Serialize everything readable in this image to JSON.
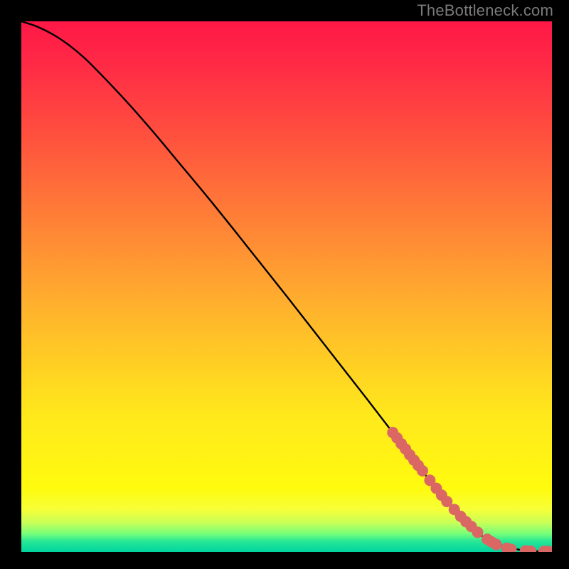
{
  "watermark": "TheBottleneck.com",
  "chart_data": {
    "type": "line",
    "title": "",
    "xlabel": "",
    "ylabel": "",
    "xlim": [
      0,
      100
    ],
    "ylim": [
      0,
      100
    ],
    "grid": false,
    "legend": false,
    "curve": {
      "name": "curve",
      "color": "#000000",
      "x": [
        0,
        3,
        6,
        9,
        12,
        15,
        20,
        25,
        30,
        35,
        40,
        45,
        50,
        55,
        60,
        65,
        70,
        75,
        80,
        83,
        86,
        88,
        90,
        92,
        94,
        96,
        98,
        100
      ],
      "y": [
        100,
        99,
        97.5,
        95.5,
        93,
        90,
        84.7,
        79,
        73,
        67,
        60.8,
        54.5,
        48.2,
        41.8,
        35.4,
        29,
        22.5,
        16,
        9.5,
        6.2,
        3.6,
        2.3,
        1.4,
        0.8,
        0.4,
        0.2,
        0.1,
        0.1
      ]
    },
    "markers": {
      "name": "points",
      "color": "#da6763",
      "radius_px": 8,
      "x": [
        70.0,
        70.8,
        71.6,
        72.4,
        73.2,
        74.0,
        74.8,
        75.6,
        77.0,
        78.2,
        79.2,
        80.2,
        81.6,
        82.8,
        83.8,
        84.8,
        86.0,
        87.8,
        88.6,
        89.5,
        91.5,
        92.3,
        95.0,
        96.0,
        98.5,
        99.3
      ],
      "y": [
        22.5,
        21.5,
        20.4,
        19.4,
        18.3,
        17.3,
        16.3,
        15.3,
        13.5,
        12.0,
        10.7,
        9.5,
        8.0,
        6.7,
        5.7,
        4.8,
        3.7,
        2.4,
        1.9,
        1.4,
        0.7,
        0.5,
        0.2,
        0.15,
        0.1,
        0.1
      ]
    }
  }
}
